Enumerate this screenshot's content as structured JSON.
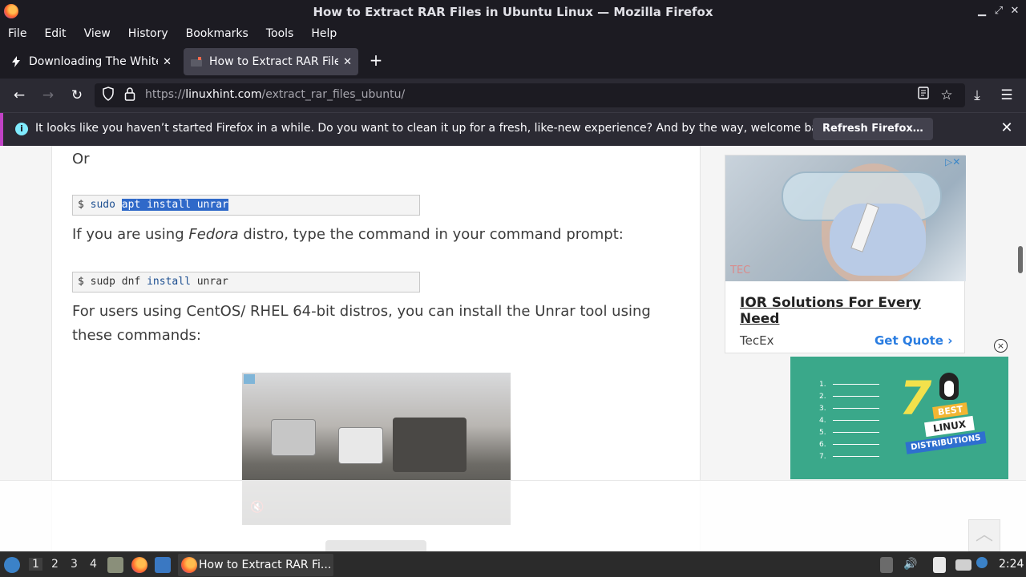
{
  "window": {
    "title": "How to Extract RAR Files in Ubuntu Linux — Mozilla Firefox",
    "controls": [
      "minimize",
      "maximize",
      "close"
    ]
  },
  "menubar": {
    "items": [
      "File",
      "Edit",
      "View",
      "History",
      "Bookmarks",
      "Tools",
      "Help"
    ]
  },
  "tabs": [
    {
      "label": "Downloading The White H",
      "active": false,
      "icon": "lightning-icon"
    },
    {
      "label": "How to Extract RAR Files",
      "active": true,
      "icon": "linuxhint-favicon"
    }
  ],
  "nav": {
    "url_prefix": "https://",
    "url_host": "linuxhint.com",
    "url_path": "/extract_rar_files_ubuntu/"
  },
  "notification": {
    "message": "It looks like you haven’t started Firefox in a while. Do you want to clean it up for a fresh, like-new experience? And by the way, welcome back!",
    "button": "Refresh Firefox…"
  },
  "article": {
    "or_text": "Or",
    "code1": {
      "prompt": "$ ",
      "cmd": "sudo",
      "selected": "apt install unrar"
    },
    "fedora_pre": "If you are using ",
    "fedora_em": "Fedora",
    "fedora_post": " distro, type the command in your command prompt:",
    "code2": {
      "prompt": "$ ",
      "cmd1": "sudp dnf ",
      "kw": "install",
      "rest": " unrar"
    },
    "centos_line1": "For users using CentOS/ RHEL 64-bit distros, you can install the Unrar tool using",
    "centos_line2": "these commands:"
  },
  "sidebar_ad": {
    "logo": "TEC",
    "headline": "IOR Solutions For Every Need",
    "brand": "TecEx",
    "cta": "Get Quote"
  },
  "linux_ad": {
    "numbers": [
      "1.",
      "2.",
      "3.",
      "4.",
      "5.",
      "6.",
      "7."
    ],
    "big": "7",
    "best": "BEST",
    "linux": "LINUX",
    "distros": "DISTRIBUTIONS"
  },
  "taskbar": {
    "workspaces": [
      "1",
      "2",
      "3",
      "4"
    ],
    "task_label": "How to Extract RAR Fi...",
    "clock": "2:24"
  }
}
